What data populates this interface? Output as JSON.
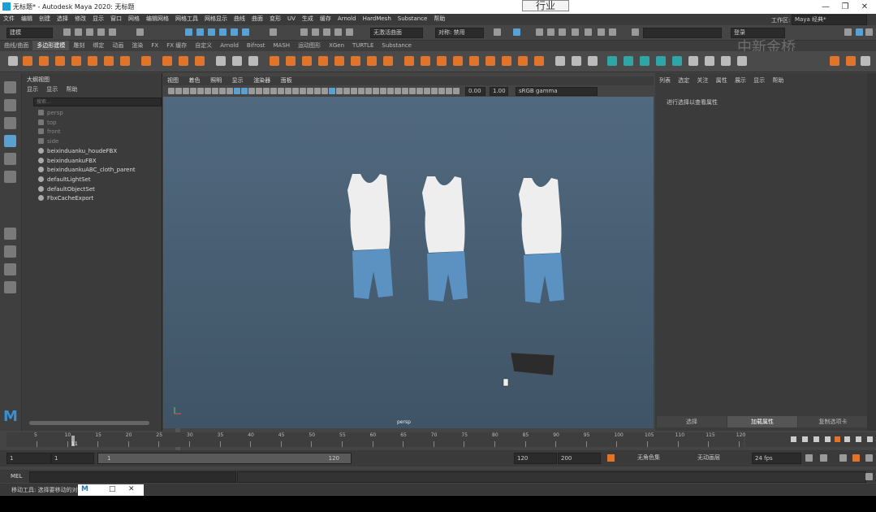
{
  "window": {
    "title": "无标题* - Autodesk Maya 2020: 无标题",
    "controls": [
      "—",
      "❐",
      "✕"
    ]
  },
  "tooltip": "行业",
  "menubar": [
    "文件",
    "编辑",
    "创建",
    "选择",
    "修改",
    "显示",
    "窗口",
    "网格",
    "编辑网格",
    "网格工具",
    "网格显示",
    "曲线",
    "曲面",
    "变形",
    "UV",
    "生成",
    "缓存",
    "Arnold",
    "HardMesh",
    "Substance",
    "帮助"
  ],
  "workspace": {
    "label": "工作区:",
    "value": "Maya 经典*"
  },
  "toolbar": {
    "mode": "建模",
    "surface": "无激活曲面",
    "symmetry": "对称: 禁用",
    "login": "登录"
  },
  "shelf_tabs": [
    "曲线/曲面",
    "多边形建模",
    "雕刻",
    "绑定",
    "动画",
    "渲染",
    "FX",
    "FX 缓存",
    "自定义",
    "Arnold",
    "Bifrost",
    "MASH",
    "运动图形",
    "XGen",
    "TURTLE",
    "Substance"
  ],
  "shelf_active": "多边形建模",
  "watermark": "中新金桥",
  "outliner": {
    "title": "大纲视图",
    "menu": [
      "显示",
      "显示",
      "帮助"
    ],
    "search_placeholder": "搜索...",
    "items": [
      {
        "label": "persp",
        "dim": true,
        "icon": "camera-icon"
      },
      {
        "label": "top",
        "dim": true,
        "icon": "camera-icon"
      },
      {
        "label": "front",
        "dim": true,
        "icon": "camera-icon"
      },
      {
        "label": "side",
        "dim": true,
        "icon": "camera-icon"
      },
      {
        "label": "beixinduanku_houdeFBX",
        "dim": false,
        "icon": "transform-icon"
      },
      {
        "label": "beixinduankuFBX",
        "dim": false,
        "icon": "transform-icon"
      },
      {
        "label": "beixinduankuABC_cloth_parent",
        "dim": false,
        "icon": "transform-icon"
      },
      {
        "label": "defaultLightSet",
        "dim": false,
        "icon": "set-icon"
      },
      {
        "label": "defaultObjectSet",
        "dim": false,
        "icon": "set-icon"
      },
      {
        "label": "FbxCacheExport",
        "dim": false,
        "icon": "set-icon"
      }
    ]
  },
  "viewport": {
    "menu": [
      "视图",
      "着色",
      "照明",
      "显示",
      "渲染器",
      "面板"
    ],
    "exposure": "0.00",
    "gamma": "1.00",
    "colorspace": "sRGB gamma",
    "camera_label": "persp"
  },
  "attribute_editor": {
    "menu": [
      "列表",
      "选定",
      "关注",
      "属性",
      "展示",
      "显示",
      "帮助"
    ],
    "placeholder_text": "进行选择以查看属性",
    "buttons": [
      "选择",
      "加载属性",
      "复制选项卡"
    ],
    "active_button": "加载属性"
  },
  "timeline": {
    "ticks": [
      "5",
      "10",
      "15",
      "20",
      "25",
      "30",
      "35",
      "40",
      "45",
      "50",
      "55",
      "60",
      "65",
      "70",
      "75",
      "80",
      "85",
      "90",
      "95",
      "100",
      "105",
      "110",
      "115",
      "120"
    ],
    "current_frame": "11"
  },
  "range": {
    "start": "1",
    "start2": "1",
    "slider_start": "1",
    "slider_end": "120",
    "end": "120",
    "end2": "200",
    "character": "无角色集",
    "layer": "无动画层",
    "fps": "24 fps"
  },
  "mel": {
    "label": "MEL"
  },
  "status": {
    "text": "移动工具: 选择要移动的对象。"
  },
  "taskbar": {
    "app": "M",
    "controls": [
      "□",
      "✕"
    ]
  }
}
